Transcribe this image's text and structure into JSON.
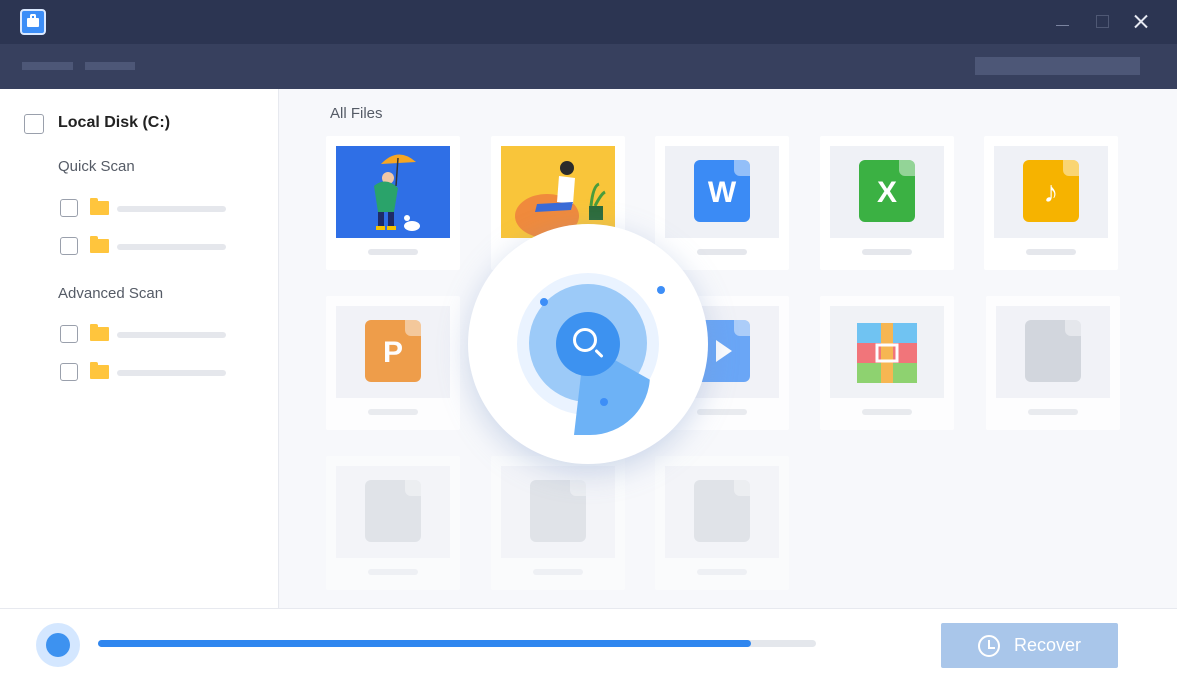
{
  "sidebar": {
    "disk_label": "Local Disk (C:)",
    "quick_scan_label": "Quick Scan",
    "advanced_scan_label": "Advanced Scan"
  },
  "main": {
    "section_title": "All Files",
    "file_types": [
      "image",
      "image",
      "word",
      "excel",
      "audio",
      "powerpoint",
      "video",
      "archive",
      "generic",
      "generic",
      "generic",
      "generic"
    ],
    "word_letter": "W",
    "excel_letter": "X",
    "ppt_letter": "P",
    "audio_glyph": "♪"
  },
  "scan": {
    "progress_fraction": 0.91
  },
  "actions": {
    "recover_label": "Recover"
  },
  "colors": {
    "titlebar": "#2c3552",
    "toolbar": "#37405e",
    "accent": "#3d8ef7",
    "recover_disabled": "#a9c6ea"
  }
}
